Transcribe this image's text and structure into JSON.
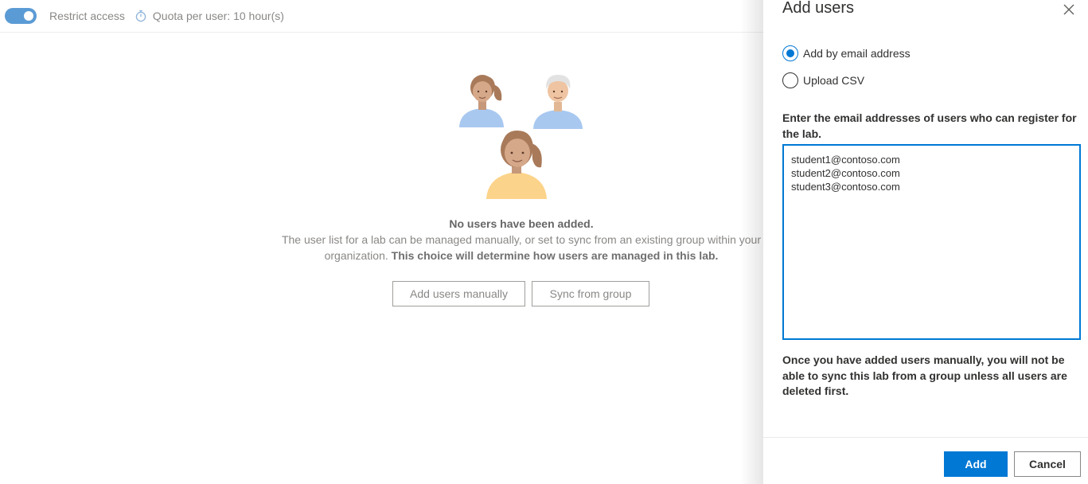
{
  "toolbar": {
    "restrict_label": "Restrict access",
    "restrict_enabled": true,
    "quota_label": "Quota per user: 10 hour(s)",
    "quota_icon": "stopwatch-icon"
  },
  "empty_state": {
    "illustration": "users-illustration",
    "title": "No users have been added.",
    "description": "The user list for a lab can be managed manually, or set to sync from an existing group within your organization.",
    "description_bold": "This choice will determine how users are managed in this lab.",
    "add_manual_label": "Add users manually",
    "sync_group_label": "Sync from group"
  },
  "panel": {
    "title": "Add users",
    "close_icon": "close-icon",
    "options": [
      {
        "label": "Add by email address",
        "selected": true
      },
      {
        "label": "Upload CSV",
        "selected": false
      }
    ],
    "email_label": "Enter the email addresses of users who can register for the lab.",
    "emails": [
      "student1@contoso.com",
      "student2@contoso.com",
      "student3@contoso.com"
    ],
    "warning": "Once you have added users manually, you will not be able to sync this lab from a group unless all users are deleted first.",
    "add_label": "Add",
    "cancel_label": "Cancel"
  },
  "colors": {
    "accent": "#0078d4",
    "toggle": "#5b9bd5"
  }
}
